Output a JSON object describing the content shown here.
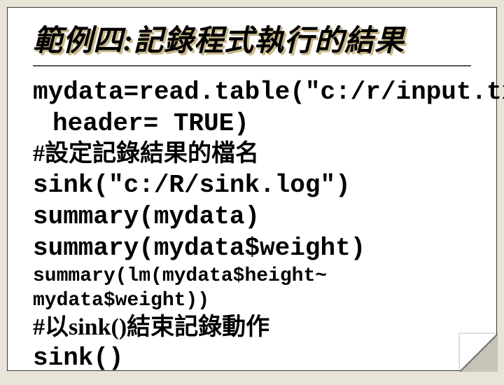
{
  "title": "範例四:記錄程式執行的結果",
  "lines": {
    "l1": "mydata=read.table(\"c:/r/input.txt\",",
    "l2": "header= TRUE)",
    "l3": "#設定記錄結果的檔名",
    "l4": "sink(\"c:/R/sink.log\")",
    "l5": "summary(mydata)",
    "l6": "summary(mydata$weight)",
    "l7": "summary(lm(mydata$height~ mydata$weight))",
    "l8": "#以sink()結束記錄動作",
    "l9": "sink()"
  }
}
